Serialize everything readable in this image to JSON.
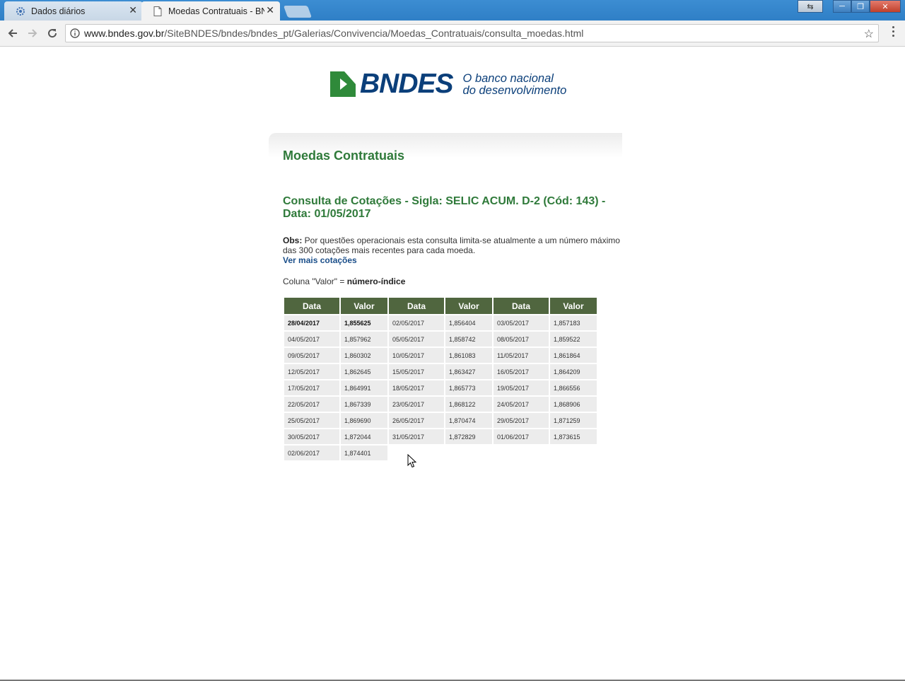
{
  "browser": {
    "tabs": [
      {
        "title": "Dados diários",
        "close": "✕"
      },
      {
        "title": "Moedas Contratuais - BN",
        "close": "✕"
      }
    ],
    "url_host": "www.bndes.gov.br",
    "url_path": "/SiteBNDES/bndes/bndes_pt/Galerias/Convivencia/Moedas_Contratuais/consulta_moedas.html",
    "star": "☆",
    "window_controls": {
      "minimize": "─",
      "maximize": "❐",
      "close": "✕",
      "switch": "⇆"
    }
  },
  "logo": {
    "wordmark": "BNDES",
    "tagline_line1": "O banco nacional",
    "tagline_line2": "do desenvolvimento",
    "brand_color": "#0b3f7a",
    "accent_color": "#2f8a3a"
  },
  "page": {
    "section_title": "Moedas Contratuais",
    "query_title": "Consulta de Cotações - Sigla: SELIC ACUM. D-2 (Cód: 143) - Data: 01/05/2017",
    "obs_label": "Obs:",
    "obs_text": " Por questões operacionais esta consulta limita-se atualmente a um número máximo das 300 cotações mais recentes para cada moeda.",
    "more_link": "Ver mais cotações",
    "coluna_prefix": "Coluna \"Valor\" = ",
    "coluna_value": "número-índice"
  },
  "table": {
    "headers": [
      "Data",
      "Valor",
      "Data",
      "Valor",
      "Data",
      "Valor"
    ],
    "rows": [
      [
        "28/04/2017",
        "1,855625",
        "02/05/2017",
        "1,856404",
        "03/05/2017",
        "1,857183"
      ],
      [
        "04/05/2017",
        "1,857962",
        "05/05/2017",
        "1,858742",
        "08/05/2017",
        "1,859522"
      ],
      [
        "09/05/2017",
        "1,860302",
        "10/05/2017",
        "1,861083",
        "11/05/2017",
        "1,861864"
      ],
      [
        "12/05/2017",
        "1,862645",
        "15/05/2017",
        "1,863427",
        "16/05/2017",
        "1,864209"
      ],
      [
        "17/05/2017",
        "1,864991",
        "18/05/2017",
        "1,865773",
        "19/05/2017",
        "1,866556"
      ],
      [
        "22/05/2017",
        "1,867339",
        "23/05/2017",
        "1,868122",
        "24/05/2017",
        "1,868906"
      ],
      [
        "25/05/2017",
        "1,869690",
        "26/05/2017",
        "1,870474",
        "29/05/2017",
        "1,871259"
      ],
      [
        "30/05/2017",
        "1,872044",
        "31/05/2017",
        "1,872829",
        "01/06/2017",
        "1,873615"
      ],
      [
        "02/06/2017",
        "1,874401",
        "",
        "",
        "",
        ""
      ]
    ],
    "header_color": "#50663f"
  }
}
